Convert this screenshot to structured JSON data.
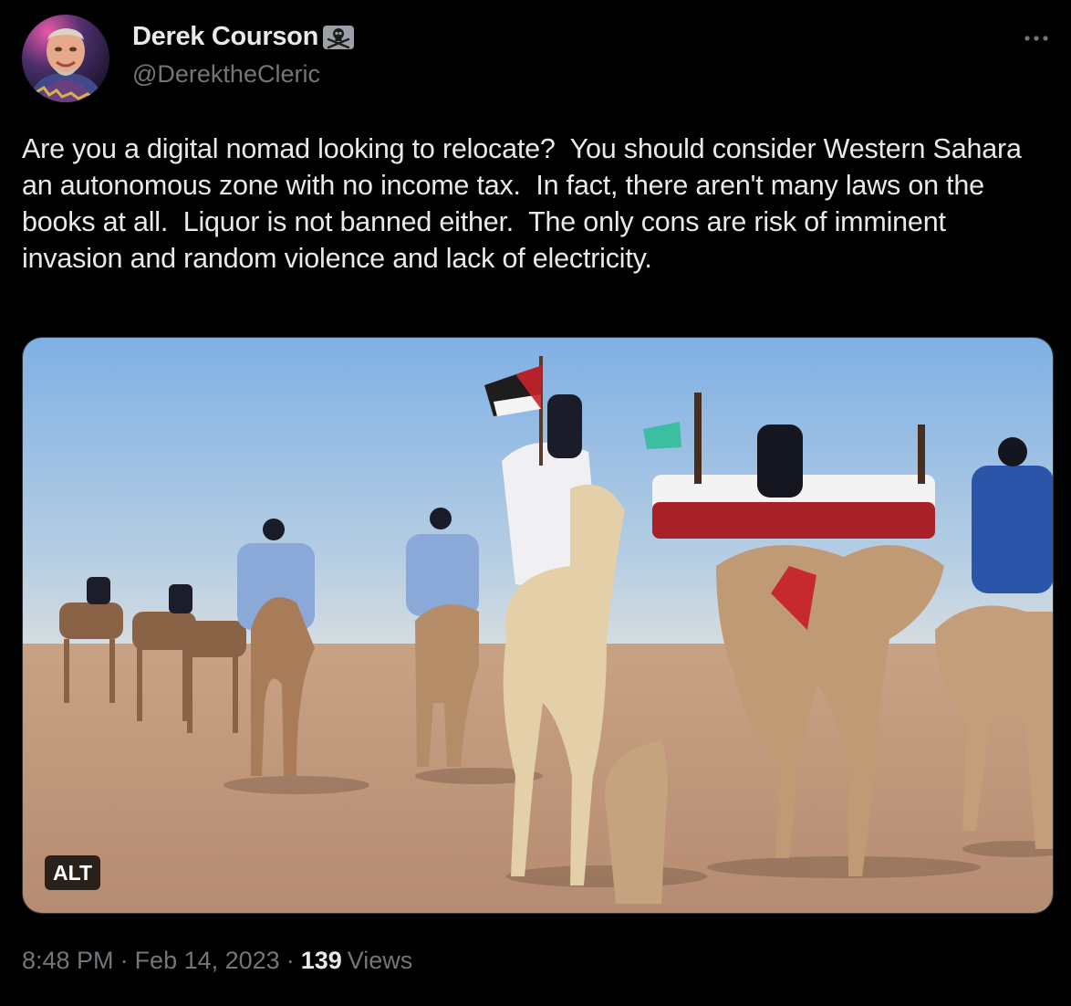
{
  "author": {
    "display_name": "Derek Courson",
    "handle": "@DerektheCleric",
    "badge_icon": "skull-crossbones-icon"
  },
  "tweet": {
    "text": "Are you a digital nomad looking to relocate?  You should consider Western Sahara an autonomous zone with no income tax.  In fact, there aren't many laws on the books at all.  Liquor is not banned either.  The only cons are risk of imminent invasion and random violence and lack of electricity."
  },
  "media": {
    "alt_label": "ALT"
  },
  "meta": {
    "time": "8:48 PM",
    "separator": "·",
    "date": "Feb 14, 2023",
    "views_count": "139",
    "views_label": "Views"
  },
  "colors": {
    "background": "#000000",
    "primary_text": "#e7e9ea",
    "secondary_text": "#71767b"
  }
}
